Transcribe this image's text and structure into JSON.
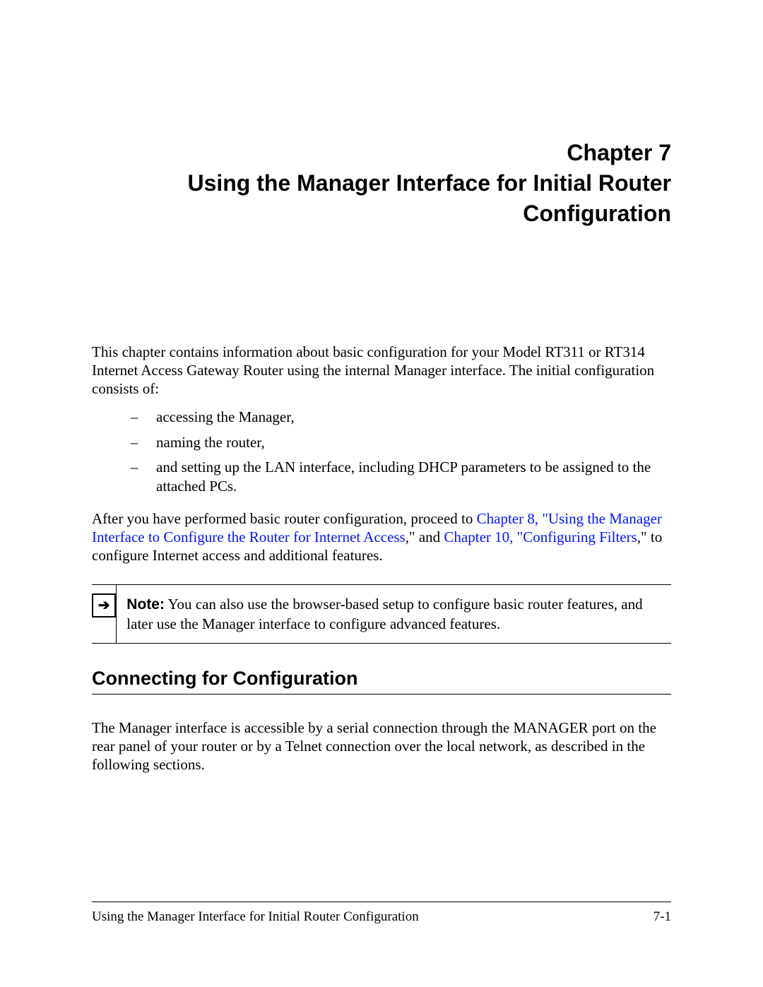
{
  "chapter": {
    "label": "Chapter 7",
    "title_line1": "Using the Manager Interface for Initial Router",
    "title_line2": "Configuration"
  },
  "intro": "This chapter contains information about basic configuration for your Model RT311 or RT314 Internet Access Gateway Router using the internal Manager interface. The initial configuration consists of:",
  "bullets": [
    "accessing the Manager,",
    "naming the router,",
    "and setting up the LAN interface, including DHCP parameters to be assigned to the attached PCs."
  ],
  "after_para": {
    "pre": "After you have performed basic router configuration, proceed to ",
    "link1": "Chapter 8, \"Using the Manager Interface to Configure the Router for Internet Access",
    "mid": ",\" and ",
    "link2": "Chapter 10, \"Configuring Filters",
    "post": ",\" to configure Internet access and additional features."
  },
  "note": {
    "label": "Note:",
    "text": " You can also use the browser-based setup to configure basic router features, and later use the Manager interface to configure advanced features."
  },
  "section": {
    "heading": "Connecting for Configuration",
    "para": "The Manager interface is accessible by a serial connection through the MANAGER port on the rear panel of your router or by a Telnet connection over the local network, as described in the following sections."
  },
  "footer": {
    "title": "Using the Manager Interface for Initial Router Configuration",
    "page": "7-1"
  }
}
